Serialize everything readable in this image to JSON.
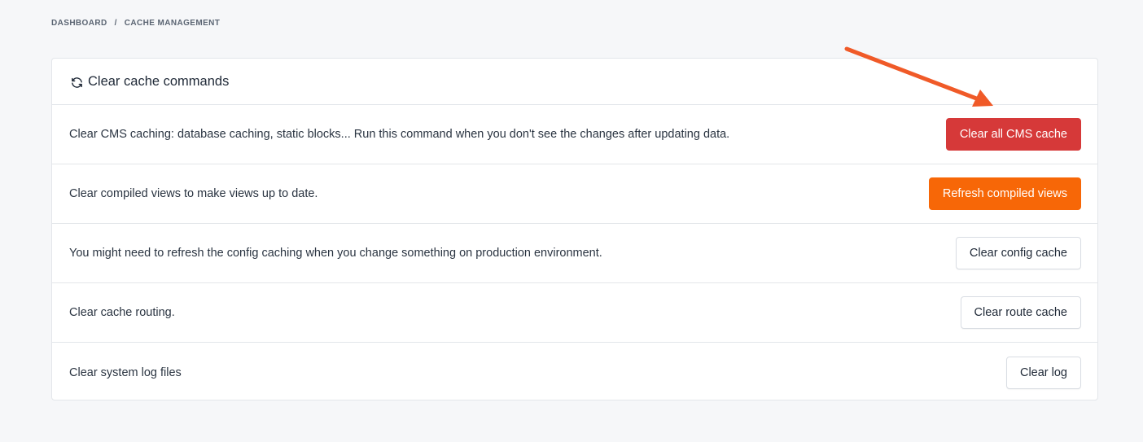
{
  "breadcrumb": {
    "items": [
      "DASHBOARD",
      "CACHE MANAGEMENT"
    ],
    "separator": "/"
  },
  "card": {
    "title": "Clear cache commands",
    "icon": "refresh-icon",
    "rows": [
      {
        "description": "Clear CMS caching: database caching, static blocks... Run this command when you don't see the changes after updating data.",
        "button_label": "Clear all CMS cache",
        "button_style": "danger"
      },
      {
        "description": "Clear compiled views to make views up to date.",
        "button_label": "Refresh compiled views",
        "button_style": "warning"
      },
      {
        "description": "You might need to refresh the config caching when you change something on production environment.",
        "button_label": "Clear config cache",
        "button_style": "default"
      },
      {
        "description": "Clear cache routing.",
        "button_label": "Clear route cache",
        "button_style": "default"
      },
      {
        "description": "Clear system log files",
        "button_label": "Clear log",
        "button_style": "default"
      }
    ]
  },
  "annotation": {
    "type": "arrow",
    "color": "#f05a28"
  },
  "colors": {
    "danger": "#d63939",
    "warning": "#f76707",
    "background": "#f6f7f9",
    "border": "#e3e6ea"
  }
}
